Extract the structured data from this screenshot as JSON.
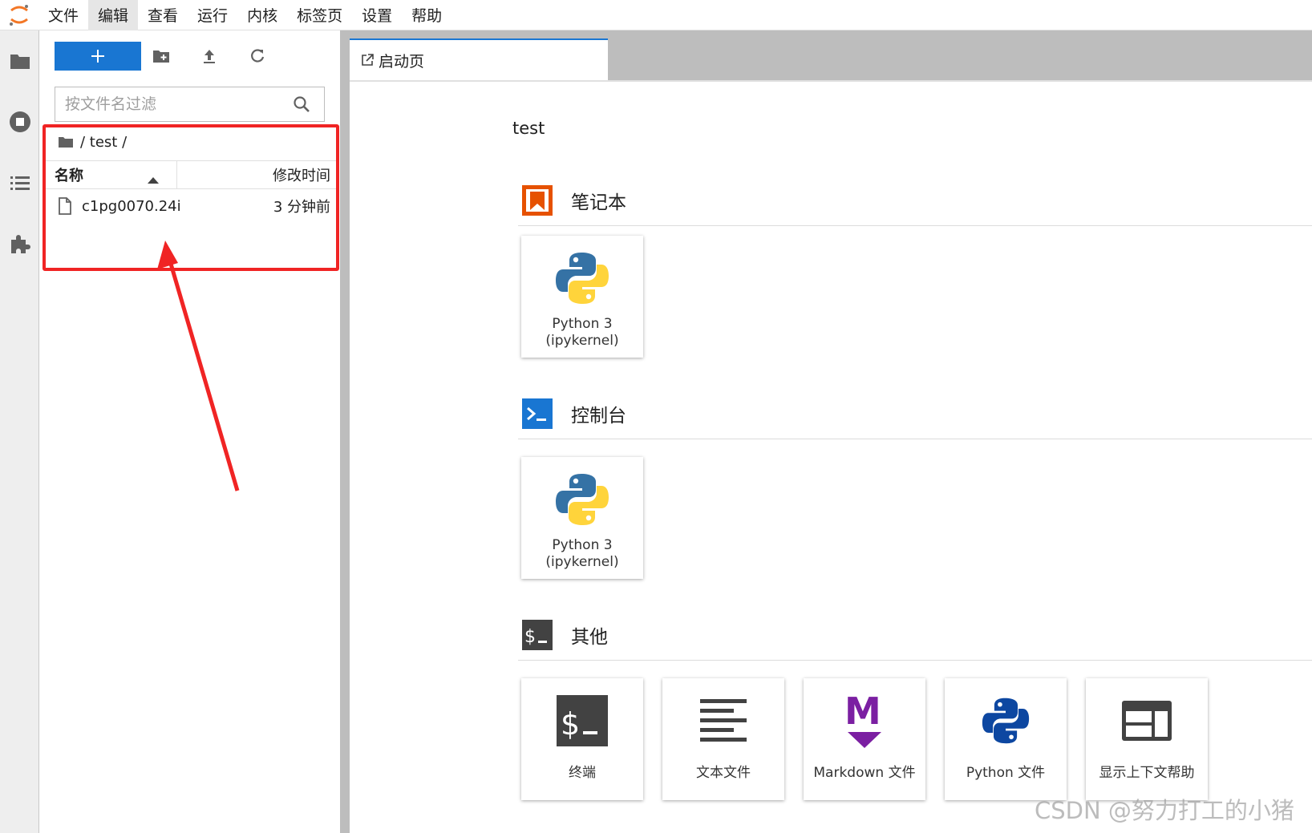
{
  "menubar": {
    "items": [
      "文件",
      "编辑",
      "查看",
      "运行",
      "内核",
      "标签页",
      "设置",
      "帮助"
    ],
    "active_index": 1
  },
  "filebrowser": {
    "filter_placeholder": "按文件名过滤",
    "breadcrumb": "/ test /",
    "columns": {
      "name": "名称",
      "modified": "修改时间"
    },
    "files": [
      {
        "name": "c1pg0070.24i",
        "modified": "3 分钟前"
      }
    ]
  },
  "tabs": [
    {
      "label": "启动页",
      "icon": "launcher-icon"
    }
  ],
  "launcher": {
    "cwd": "test",
    "sections": [
      {
        "title": "笔记本",
        "icon": "notebook-icon",
        "color": "#e65100",
        "cards": [
          {
            "label": "Python 3\n(ipykernel)",
            "icon": "python-logo-icon"
          }
        ]
      },
      {
        "title": "控制台",
        "icon": "console-icon",
        "color": "#1976d2",
        "cards": [
          {
            "label": "Python 3\n(ipykernel)",
            "icon": "python-logo-icon"
          }
        ]
      },
      {
        "title": "其他",
        "icon": "terminal-icon",
        "color": "#424242",
        "cards": [
          {
            "label": "终端",
            "icon": "terminal-icon"
          },
          {
            "label": "文本文件",
            "icon": "text-file-icon"
          },
          {
            "label": "Markdown 文件",
            "icon": "markdown-icon"
          },
          {
            "label": "Python 文件",
            "icon": "python-file-icon"
          },
          {
            "label": "显示上下文帮助",
            "icon": "context-help-icon"
          }
        ]
      }
    ]
  },
  "colors": {
    "accent": "#1976d2",
    "highlight": "#f02424",
    "notebook": "#e65100",
    "markdown": "#7b1fa2"
  },
  "watermark": "CSDN @努力打工的小猪"
}
